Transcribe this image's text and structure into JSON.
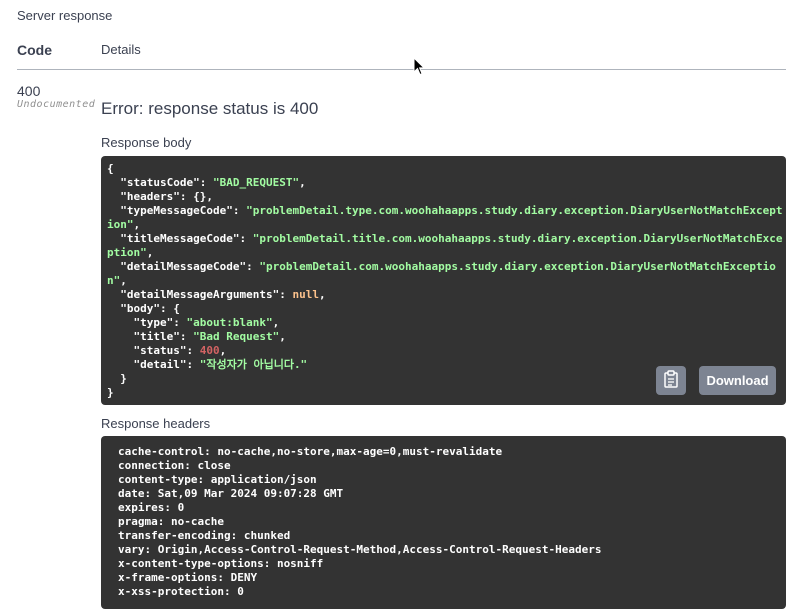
{
  "header": {
    "section_title": "Server response",
    "col_code": "Code",
    "col_details": "Details"
  },
  "response": {
    "code": "400",
    "undocumented": "Undocumented",
    "error": "Error: response status is 400",
    "body_label": "Response body",
    "headers_label": "Response headers",
    "download_label": "Download"
  },
  "body": {
    "open": "{",
    "statusCode_key": "\"statusCode\"",
    "statusCode_val": "\"BAD_REQUEST\"",
    "headers_key": "\"headers\"",
    "headers_val": "{},",
    "typeMessageCode_key": "\"typeMessageCode\"",
    "typeMessageCode_val_1": "\"problemDetail.type.com.woohahaapps.study.diary.exception.DiaryUserNotMatchExcept",
    "typeMessageCode_val_2": "ion\"",
    "titleMessageCode_key": "\"titleMessageCode\"",
    "titleMessageCode_val_1": "\"problemDetail.title.com.woohahaapps.study.diary.exception.DiaryUserNotMatchExce",
    "titleMessageCode_val_2": "ption\"",
    "detailMessageCode_key": "\"detailMessageCode\"",
    "detailMessageCode_val_1": "\"problemDetail.com.woohahaapps.study.diary.exception.DiaryUserNotMatchExceptio",
    "detailMessageCode_val_2": "n\"",
    "detailMessageArguments_key": "\"detailMessageArguments\"",
    "detailMessageArguments_val": "null",
    "body_key": "\"body\"",
    "body_open": "{",
    "type_key": "\"type\"",
    "type_val": "\"about:blank\"",
    "title_key": "\"title\"",
    "title_val": "\"Bad Request\"",
    "status_key": "\"status\"",
    "status_val": "400",
    "detail_key": "\"detail\"",
    "detail_val": "\"작성자가 아닙니다.\"",
    "inner_close": "}",
    "close": "}"
  },
  "response_headers": [
    "cache-control: no-cache,no-store,max-age=0,must-revalidate",
    "connection: close",
    "content-type: application/json",
    "date: Sat,09 Mar 2024 09:07:28 GMT",
    "expires: 0",
    "pragma: no-cache",
    "transfer-encoding: chunked",
    "vary: Origin,Access-Control-Request-Method,Access-Control-Request-Headers",
    "x-content-type-options: nosniff",
    "x-frame-options: DENY",
    "x-xss-protection: 0"
  ],
  "icons": {
    "copy": "clipboard-icon",
    "cursor": "mouse-cursor-icon"
  }
}
